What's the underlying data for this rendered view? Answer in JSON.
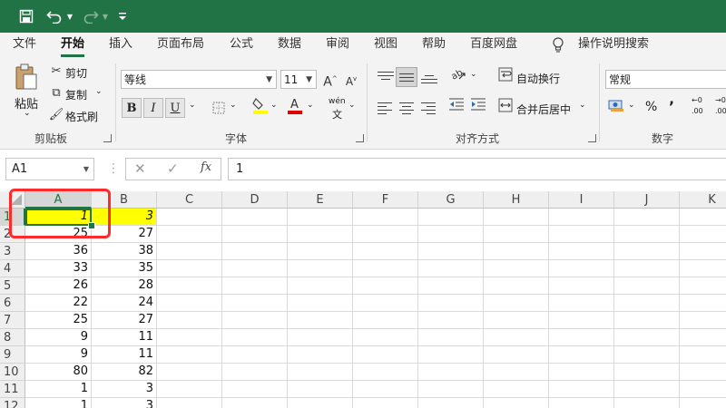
{
  "menu": {
    "tabs": [
      "文件",
      "开始",
      "插入",
      "页面布局",
      "公式",
      "数据",
      "审阅",
      "视图",
      "帮助",
      "百度网盘"
    ],
    "active_tab": "开始",
    "tell_me": "操作说明搜索"
  },
  "ribbon": {
    "clipboard": {
      "paste": "粘贴",
      "cut": "剪切",
      "copy": "复制",
      "format_painter": "格式刷",
      "group": "剪贴板"
    },
    "font": {
      "name": "等线",
      "size": "11",
      "bold": "B",
      "italic": "I",
      "underline": "U",
      "group": "字体",
      "phonetic_top": "wén",
      "phonetic_bottom": "文"
    },
    "alignment": {
      "wrap_text": "自动换行",
      "merge_center": "合并后居中",
      "group": "对齐方式"
    },
    "number": {
      "format": "常规",
      "percent": "%",
      "comma": "’",
      "group": "数字",
      "inc_dec_top": "←0",
      "inc_dec_bottom": ".00",
      "dec_dec_top": "→0",
      "dec_dec_bottom": ".00"
    }
  },
  "formula_bar": {
    "name_box": "A1",
    "fx": "fx",
    "value": "1"
  },
  "grid": {
    "columns": [
      "A",
      "B",
      "C",
      "D",
      "E",
      "F",
      "G",
      "H",
      "I",
      "J",
      "K"
    ],
    "rows": [
      {
        "n": "1",
        "a": "1",
        "b": "3"
      },
      {
        "n": "2",
        "a": "25",
        "b": "27"
      },
      {
        "n": "3",
        "a": "36",
        "b": "38"
      },
      {
        "n": "4",
        "a": "33",
        "b": "35"
      },
      {
        "n": "5",
        "a": "26",
        "b": "28"
      },
      {
        "n": "6",
        "a": "22",
        "b": "24"
      },
      {
        "n": "7",
        "a": "25",
        "b": "27"
      },
      {
        "n": "8",
        "a": "9",
        "b": "11"
      },
      {
        "n": "9",
        "a": "9",
        "b": "11"
      },
      {
        "n": "10",
        "a": "80",
        "b": "82"
      },
      {
        "n": "11",
        "a": "1",
        "b": "3"
      },
      {
        "n": "12",
        "a": "1",
        "b": "3"
      }
    ],
    "selected_cell": "A1",
    "highlight_color": "#ffff00"
  },
  "colors": {
    "accent": "#217346",
    "annotation": "#ff2a2a"
  }
}
